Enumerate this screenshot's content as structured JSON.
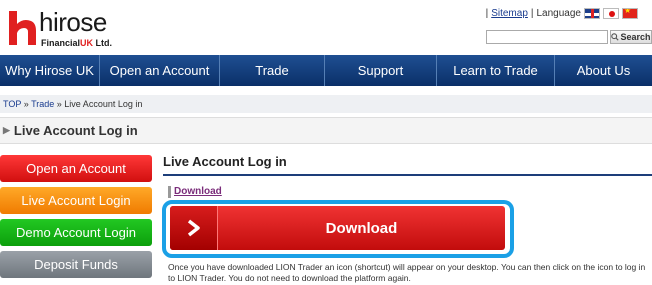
{
  "brand": {
    "name": "hirose",
    "sub_a": "Financial",
    "sub_b": "UK",
    "sub_c": " Ltd."
  },
  "toplinks": {
    "sitemap": "Sitemap",
    "sep1": "|",
    "sep2": "|",
    "language": "Language"
  },
  "search": {
    "placeholder": "",
    "button": "Search"
  },
  "nav": [
    "Why Hirose UK",
    "Open an Account",
    "Trade",
    "Support",
    "Learn to Trade",
    "About Us"
  ],
  "breadcrumb": {
    "top": "TOP",
    "sep": "»",
    "trade": "Trade",
    "current": "Live Account Log in"
  },
  "page_title": "Live Account Log in",
  "sidebar": [
    "Open an Account",
    "Live Account Login",
    "Demo Account Login",
    "Deposit Funds"
  ],
  "content": {
    "section_title": "Live Account Log in",
    "download_link": "Download",
    "download_button": "Download",
    "description": "Once you have downloaded LION Trader an icon (shortcut) will appear on your desktop. You can then click on the icon to log in to LION Trader. You do not need to download the platform again."
  },
  "colors": {
    "nav": "#0a2f68",
    "download": "#e01f1f",
    "highlight": "#1aa0e6"
  }
}
